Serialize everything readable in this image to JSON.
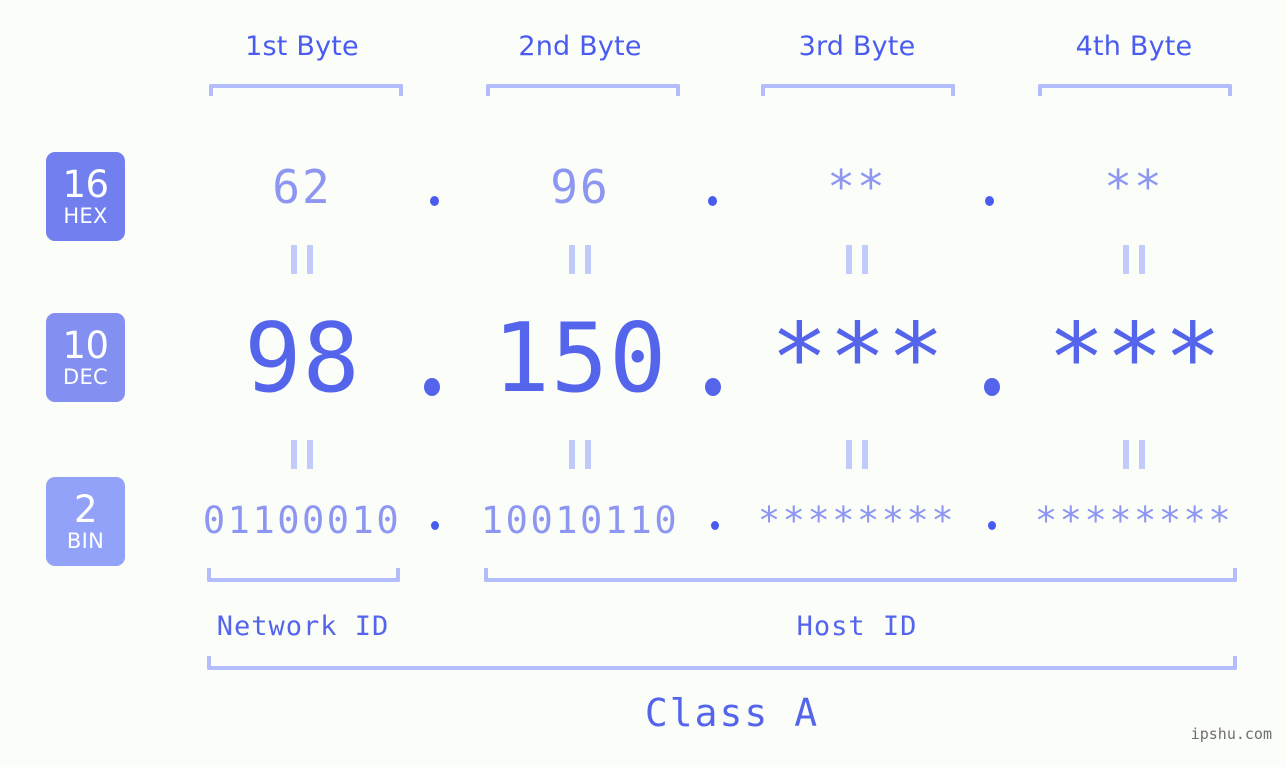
{
  "background_color": "#fbfdf8",
  "accent_colors": {
    "primary_blue": "#4a5cf0",
    "dec_blue": "#5465eb",
    "light_blue": "#8d97f2",
    "bracket_blue": "#b4bdfb",
    "badge_hex": "#7280ef",
    "badge_dec": "#8390f2",
    "badge_bin": "#91a2f8"
  },
  "byte_headers": [
    {
      "label": "1st Byte"
    },
    {
      "label": "2nd Byte"
    },
    {
      "label": "3rd Byte"
    },
    {
      "label": "4th Byte"
    }
  ],
  "bases": [
    {
      "number": "16",
      "name": "HEX"
    },
    {
      "number": "10",
      "name": "DEC"
    },
    {
      "number": "2",
      "name": "BIN"
    }
  ],
  "rows": {
    "hex": {
      "base_number": "16",
      "base_name": "HEX",
      "values": [
        "62",
        "96",
        "**",
        "**"
      ],
      "separator": "."
    },
    "dec": {
      "base_number": "10",
      "base_name": "DEC",
      "values": [
        "98",
        "150",
        "***",
        "***"
      ],
      "separator": "."
    },
    "bin": {
      "base_number": "2",
      "base_name": "BIN",
      "values": [
        "01100010",
        "10010110",
        "********",
        "********"
      ],
      "separator": "."
    }
  },
  "equality_markers": {
    "glyph": "||",
    "count_per_gap": 4
  },
  "sections": [
    {
      "label": "Network ID",
      "bytes": 1
    },
    {
      "label": "Host ID",
      "bytes": 3
    }
  ],
  "class": {
    "label": "Class A"
  },
  "watermark": {
    "text": "ipshu.com"
  }
}
